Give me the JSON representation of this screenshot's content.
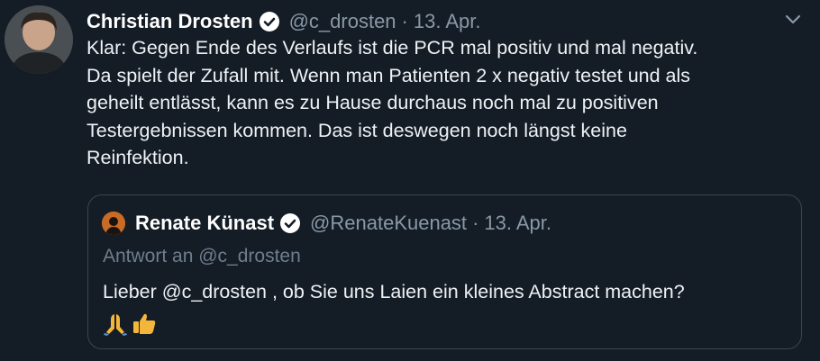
{
  "tweet": {
    "author_name": "Christian Drosten",
    "author_handle": "@c_drosten",
    "separator": "·",
    "date": "13. Apr.",
    "text_lines": [
      "Klar: Gegen Ende des Verlaufs ist die PCR mal positiv und mal negativ.",
      "Da spielt der Zufall mit. Wenn man Patienten 2 x negativ testet und als",
      "geheilt entlässt, kann es zu Hause durchaus noch mal zu positiven",
      "Testergebnissen kommen. Das ist deswegen noch längst keine",
      "Reinfektion."
    ]
  },
  "quoted_tweet": {
    "author_name": "Renate Künast",
    "author_handle": "@RenateKuenast",
    "separator": "·",
    "date": "13. Apr.",
    "reply_context": "Antwort an @c_drosten",
    "text": "Lieber @c_drosten , ob Sie uns Laien ein kleines Abstract machen?",
    "emojis": [
      "folded-hands-emoji",
      "thumbs-up-emoji"
    ]
  },
  "colors": {
    "background": "#141c26",
    "secondary_text": "#8899a6",
    "verified_badge": "#ffffff",
    "quote_border": "#3a4652"
  }
}
